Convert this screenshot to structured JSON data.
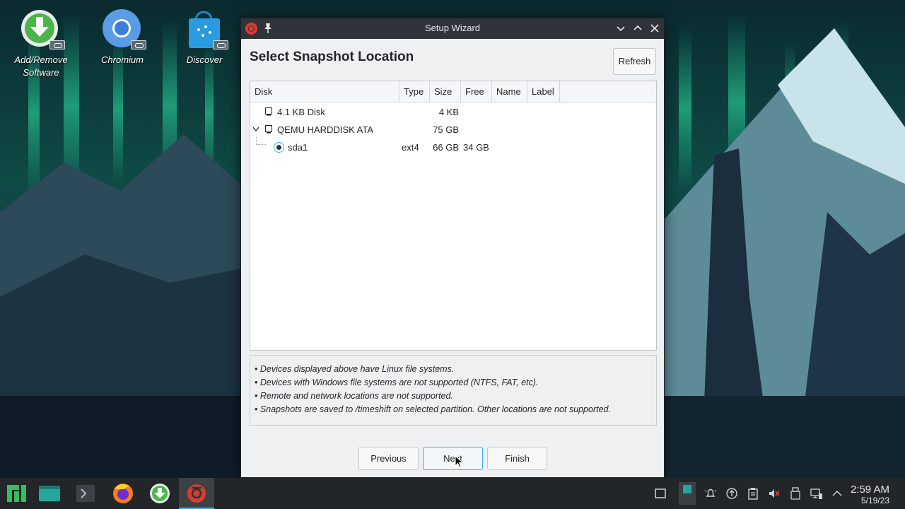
{
  "desktop": {
    "icons": [
      {
        "label_line1": "Add/Remove",
        "label_line2": "Software",
        "icon": "download-arrow-icon"
      },
      {
        "label_line1": "Chromium",
        "icon": "chromium-icon"
      },
      {
        "label_line1": "Discover",
        "icon": "discover-bag-icon"
      }
    ]
  },
  "window": {
    "title": "Setup Wizard",
    "heading": "Select Snapshot Location",
    "refresh_label": "Refresh",
    "columns": [
      "Disk",
      "Type",
      "Size",
      "Free",
      "Name",
      "Label"
    ],
    "rows": [
      {
        "disk": "4.1 KB Disk",
        "type": "",
        "size": "4 KB",
        "free": "",
        "name": "",
        "label": ""
      },
      {
        "disk": "QEMU HARDDISK ATA",
        "type": "",
        "size": "75 GB",
        "free": "",
        "name": "",
        "label": "",
        "expanded": true
      },
      {
        "disk": "sda1",
        "type": "ext4",
        "size": "66 GB",
        "free": "34 GB",
        "name": "",
        "label": "",
        "selected": true
      }
    ],
    "notes": [
      "• Devices displayed above have Linux file systems.",
      "• Devices with Windows file systems are not supported (NTFS, FAT, etc).",
      "• Remote and network locations are not supported.",
      "• Snapshots are saved to /timeshift on selected partition. Other locations are not supported."
    ],
    "buttons": {
      "previous": "Previous",
      "next": "Next",
      "finish": "Finish"
    }
  },
  "taskbar": {
    "items": [
      "manjaro-menu-icon",
      "file-manager-icon",
      "terminal-icon",
      "firefox-icon",
      "software-install-icon",
      "timeshift-icon"
    ],
    "active_item": "timeshift-icon",
    "tray": [
      "show-desktop-icon",
      "pager-icon",
      "notifications-icon",
      "updates-icon",
      "clipboard-icon",
      "volume-muted-icon",
      "usb-icon",
      "network-icon",
      "expand-tray-icon"
    ],
    "time": "2:59 AM",
    "date": "5/19/23"
  },
  "colors": {
    "accent": "#3daee9",
    "titlebar": "#2f343a",
    "timeshift_red": "#d93c2f",
    "window_bg": "#eff0f1"
  }
}
